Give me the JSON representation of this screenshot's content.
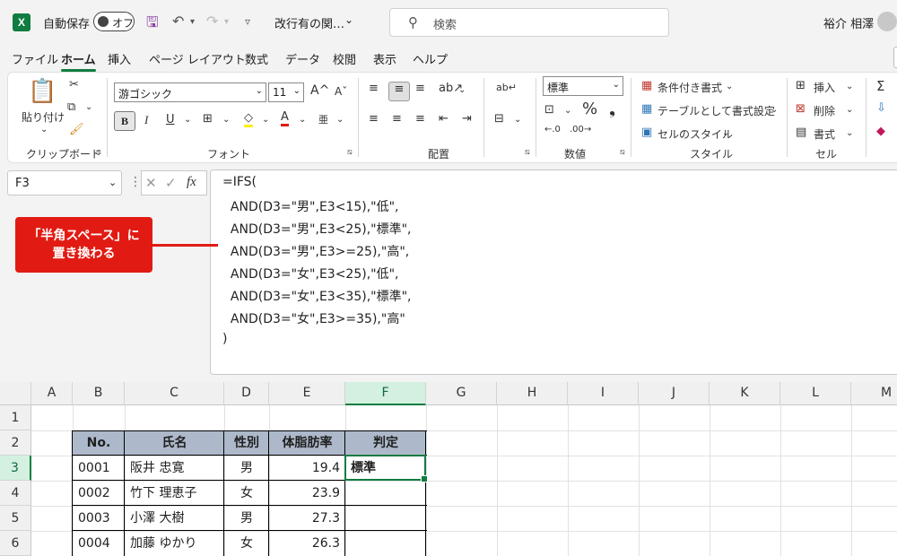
{
  "titlebar": {
    "app_icon": "excel-icon",
    "autosave_label": "自動保存",
    "autosave_state": "オフ",
    "doc_name": "改行有の関…",
    "search_placeholder": "検索",
    "user_name": "裕介 相澤"
  },
  "menu": {
    "tabs": [
      "ファイル",
      "ホーム",
      "挿入",
      "ページ レイアウト",
      "数式",
      "データ",
      "校閲",
      "表示",
      "ヘルプ"
    ],
    "active": "ホーム"
  },
  "ribbon": {
    "clipboard": {
      "paste_label": "貼り付け",
      "group_label": "クリップボード"
    },
    "font": {
      "family": "游ゴシック",
      "size": "11",
      "bold": "B",
      "italic": "I",
      "underline": "U",
      "group_label": "フォント"
    },
    "alignment": {
      "group_label": "配置"
    },
    "number": {
      "format": "標準",
      "percent": "%",
      "comma": "❟",
      "group_label": "数値"
    },
    "styles": {
      "conditional": "条件付き書式",
      "table": "テーブルとして書式設定",
      "cell_style": "セルのスタイル",
      "group_label": "スタイル"
    },
    "cells": {
      "insert": "挿入",
      "delete": "削除",
      "format": "書式",
      "group_label": "セル"
    },
    "editing": {
      "sum_icon": "Σ"
    }
  },
  "formula_bar": {
    "name_box": "F3",
    "fx_label": "fx",
    "lines": [
      "=IFS(",
      "  AND(D3=\"男\",E3<15),\"低\",",
      "  AND(D3=\"男\",E3<25),\"標準\",",
      "  AND(D3=\"男\",E3>=25),\"高\",",
      "  AND(D3=\"女\",E3<25),\"低\",",
      "  AND(D3=\"女\",E3<35),\"標準\",",
      "  AND(D3=\"女\",E3>=35),\"高\"",
      ")"
    ]
  },
  "callout": {
    "line1": "「半角スペース」に",
    "line2": "置き換わる",
    "color": "#e11b13"
  },
  "sheet": {
    "columns": [
      "A",
      "B",
      "C",
      "D",
      "E",
      "F",
      "G",
      "H",
      "I",
      "J",
      "K",
      "L",
      "M"
    ],
    "rows": [
      "1",
      "2",
      "3",
      "4",
      "5",
      "6"
    ],
    "selected_column": "F",
    "selected_row": "3",
    "table_header": [
      "No.",
      "氏名",
      "性別",
      "体脂肪率",
      "判定"
    ],
    "table_rows": [
      [
        "0001",
        "阪井 忠寛",
        "男",
        "19.4",
        "標準"
      ],
      [
        "0002",
        "竹下 理恵子",
        "女",
        "23.9",
        ""
      ],
      [
        "0003",
        "小澤 大樹",
        "男",
        "27.3",
        ""
      ],
      [
        "0004",
        "加藤 ゆかり",
        "女",
        "26.3",
        ""
      ]
    ],
    "header_fill": "#adb9ca",
    "accent": "#107c41"
  }
}
